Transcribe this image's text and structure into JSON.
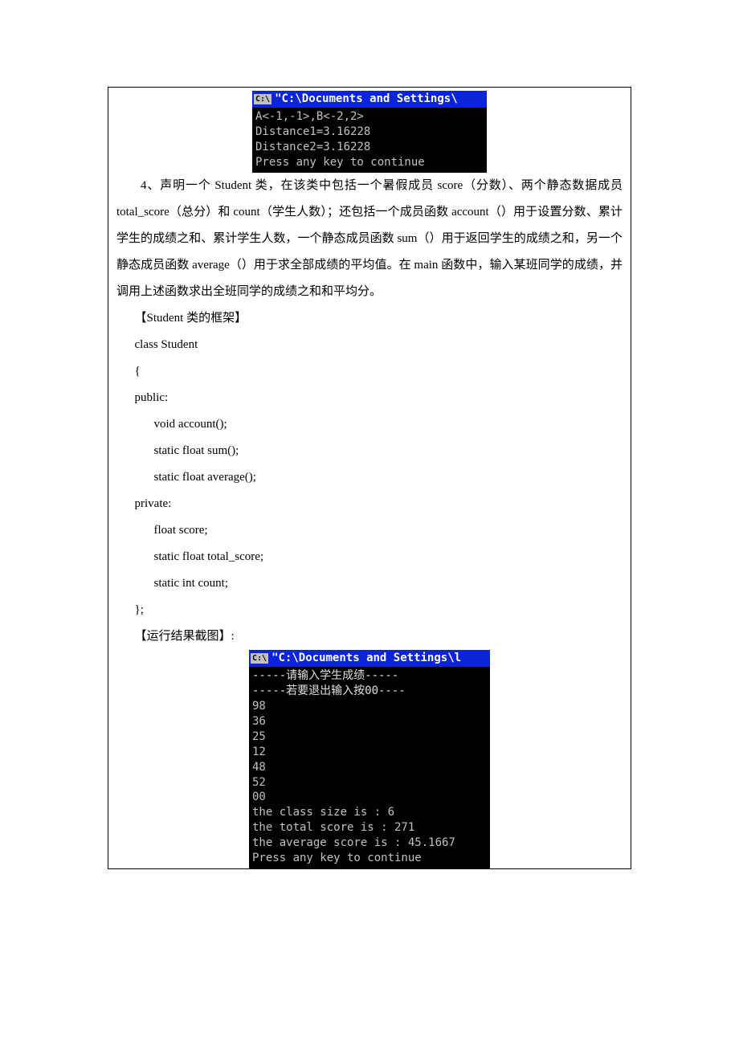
{
  "console1": {
    "win_icon_label": "C:\\",
    "title": "\"C:\\Documents and Settings\\",
    "lines": [
      "A<-1,-1>,B<-2,2>",
      "Distance1=3.16228",
      "Distance2=3.16228",
      "Press any key to continue"
    ]
  },
  "problem4": {
    "text": "4、声明一个 Student 类，在该类中包括一个暑假成员 score（分数）、两个静态数据成员 total_score（总分）和 count（学生人数）；还包括一个成员函数 account（）用于设置分数、累计学生的成绩之和、累计学生人数，一个静态成员函数 sum（）用于返回学生的成绩之和，另一个静态成员函数 average（）用于求全部成绩的平均值。在 main 函数中，输入某班同学的成绩，并调用上述函数求出全班同学的成绩之和和平均分。"
  },
  "framework_label": "【Student 类的框架】",
  "code": {
    "l1": "class Student",
    "l2": "{",
    "l3": "public:",
    "l4": "void account();",
    "l5": "static float sum();",
    "l6": "static float average();",
    "l7": "private:",
    "l8": "float score;",
    "l9": "static float total_score;",
    "l10": "static int count;",
    "l11": "};"
  },
  "result_label": "【运行结果截图】:",
  "console2": {
    "win_icon_label": "C:\\",
    "title": "\"C:\\Documents and Settings\\l",
    "hint_line1": "-----请输入学生成绩-----",
    "hint_line2": "-----若要退出输入按00----",
    "inputs": [
      "98",
      "36",
      "25",
      "12",
      "48",
      "52",
      "00"
    ],
    "out_size": "the class size is : 6",
    "out_total": "the total score is : 271",
    "out_avg": "the average score is : 45.1667",
    "out_press": "Press any key to continue"
  }
}
